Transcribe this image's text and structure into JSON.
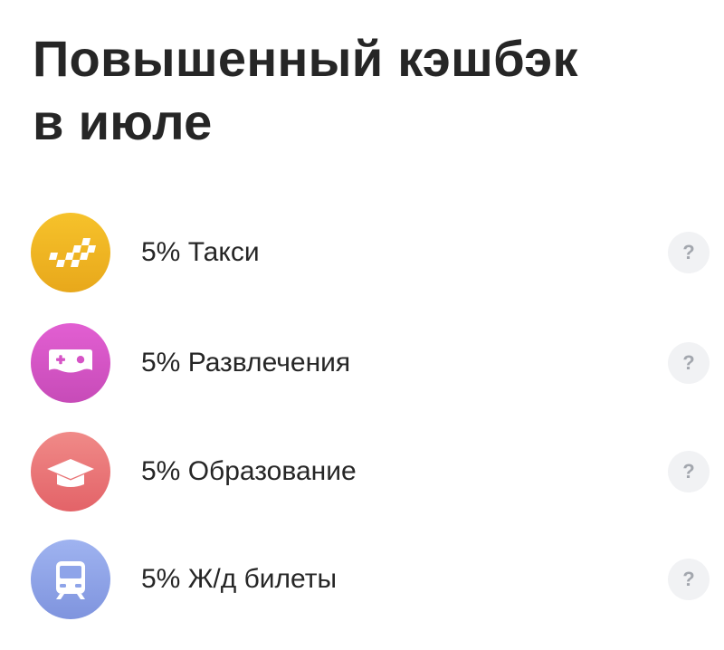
{
  "title": {
    "line1": "Повышенный кэшбэк",
    "line2": "в июле"
  },
  "categories": [
    {
      "label": "5% Такси",
      "icon": "taxi-checker-icon",
      "color": "#f0b321",
      "help": "?"
    },
    {
      "label": "5% Развлечения",
      "icon": "gamepad-icon",
      "color": "#d653c6",
      "help": "?"
    },
    {
      "label": "5% Образование",
      "icon": "graduation-cap-icon",
      "color": "#ea6f73",
      "help": "?"
    },
    {
      "label": "5% Ж/д билеты",
      "icon": "train-icon",
      "color": "#8ea4e9",
      "help": "?"
    }
  ]
}
